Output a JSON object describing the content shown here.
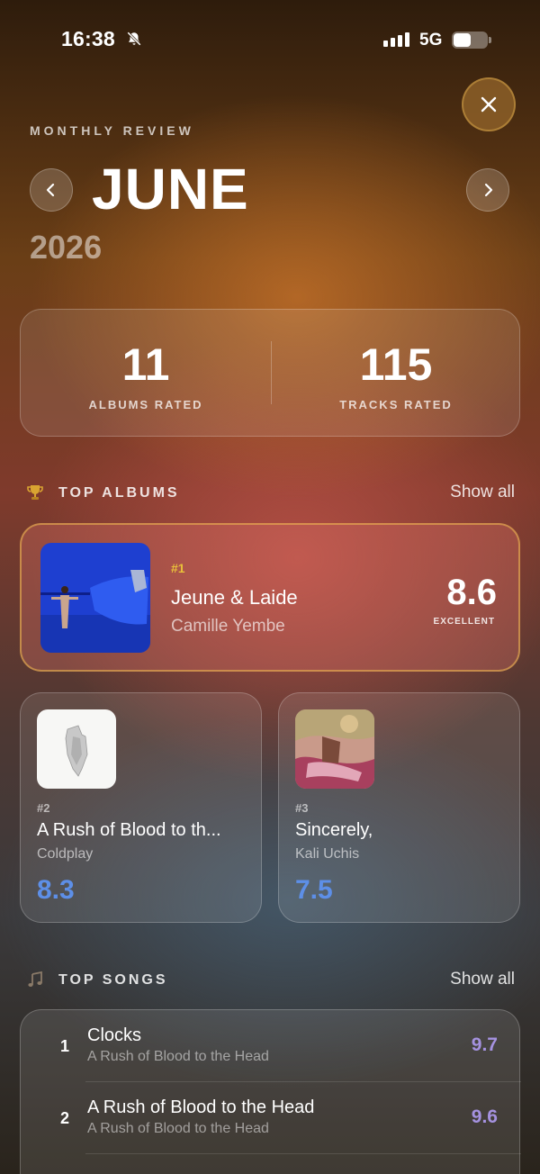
{
  "status": {
    "time": "16:38",
    "network": "5G"
  },
  "header": {
    "eyebrow": "MONTHLY REVIEW",
    "month": "JUNE",
    "year": "2026"
  },
  "stats": {
    "albums_count": "11",
    "albums_label": "ALBUMS RATED",
    "tracks_count": "115",
    "tracks_label": "TRACKS RATED"
  },
  "top_albums": {
    "heading": "TOP ALBUMS",
    "show_all": "Show all",
    "items": [
      {
        "rank": "#1",
        "title": "Jeune & Laide",
        "artist": "Camille Yembe",
        "score": "8.6",
        "score_label": "EXCELLENT"
      },
      {
        "rank": "#2",
        "title": "A Rush of Blood to th...",
        "artist": "Coldplay",
        "score": "8.3"
      },
      {
        "rank": "#3",
        "title": "Sincerely,",
        "artist": "Kali Uchis",
        "score": "7.5"
      }
    ]
  },
  "top_songs": {
    "heading": "TOP SONGS",
    "show_all": "Show all",
    "items": [
      {
        "num": "1",
        "title": "Clocks",
        "album": "A Rush of Blood to the Head",
        "score": "9.7"
      },
      {
        "num": "2",
        "title": "A Rush of Blood to the Head",
        "album": "A Rush of Blood to the Head",
        "score": "9.6"
      }
    ]
  },
  "colors": {
    "gold_rank": "#e8bf3a",
    "blue_score": "#5d8fe8",
    "purple_score": "#a592e0"
  },
  "icons": [
    "bell-slash-icon",
    "signal-icon",
    "battery-icon",
    "close-icon",
    "chevron-left-icon",
    "chevron-right-icon",
    "trophy-icon",
    "music-note-icon"
  ]
}
